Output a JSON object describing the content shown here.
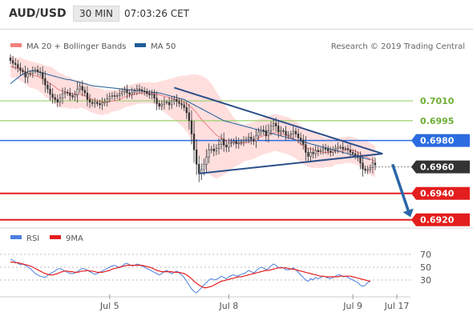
{
  "header": {
    "pair": "AUD/USD",
    "timeframe": "30 MIN",
    "time": "07:03:26 CET"
  },
  "colors": {
    "candle": "#333333",
    "ma20": "#f08080",
    "bollinger_fill": "#ffd3d3",
    "ma50": "#1f5c99",
    "trendline": "#2c4f8a",
    "green_level": "#9bd06a",
    "blue_level": "#2b6ce0",
    "red_level": "#e31e1e",
    "arrow": "#2a66a8",
    "rsi": "#4a7fe0",
    "rsi_ma": "#e61c1c"
  },
  "chart_data": [
    {
      "type": "candlestick",
      "name": "price",
      "legend": [
        {
          "label": "MA 20 + Bollinger Bands",
          "color": "#f08080"
        },
        {
          "label": "MA 50",
          "color": "#1f5c99"
        }
      ],
      "watermark": "Research © 2019 Trading Central",
      "ylim": [
        0.6915,
        0.705
      ],
      "closes": [
        0.70405,
        0.70385,
        0.70375,
        0.7035,
        0.7033,
        0.7032,
        0.7028,
        0.70305,
        0.7031,
        0.70325,
        0.70335,
        0.7032,
        0.70315,
        0.7027,
        0.7022,
        0.7019,
        0.7015,
        0.70125,
        0.7011,
        0.7009,
        0.7012,
        0.70155,
        0.70165,
        0.7016,
        0.7014,
        0.7013,
        0.70145,
        0.7019,
        0.7021,
        0.7018,
        0.7016,
        0.7011,
        0.7009,
        0.7008,
        0.7009,
        0.7008,
        0.7007,
        0.70085,
        0.70095,
        0.70115,
        0.70135,
        0.7014,
        0.70135,
        0.7014,
        0.70155,
        0.7017,
        0.7018,
        0.7016,
        0.7015,
        0.70165,
        0.70175,
        0.7019,
        0.70185,
        0.70175,
        0.7017,
        0.70155,
        0.70145,
        0.7015,
        0.7012,
        0.7008,
        0.7006,
        0.70075,
        0.7009,
        0.7009,
        0.7007,
        0.701,
        0.7011,
        0.70095,
        0.7008,
        0.7007,
        0.7005,
        0.7001,
        0.6995,
        0.6985,
        0.6973,
        0.6962,
        0.6955,
        0.6958,
        0.6962,
        0.69675,
        0.6973,
        0.69735,
        0.6972,
        0.6974,
        0.6977,
        0.6981,
        0.69765,
        0.6975,
        0.6978,
        0.69785,
        0.69795,
        0.69775,
        0.69785,
        0.6979,
        0.698,
        0.6981,
        0.69825,
        0.6981,
        0.69795,
        0.69835,
        0.69865,
        0.6988,
        0.69875,
        0.69835,
        0.69875,
        0.6991,
        0.6993,
        0.6991,
        0.69865,
        0.69875,
        0.6987,
        0.6984,
        0.6984,
        0.6985,
        0.6987,
        0.6985,
        0.6982,
        0.69805,
        0.6977,
        0.6971,
        0.6968,
        0.6971,
        0.697,
        0.69725,
        0.69715,
        0.69725,
        0.6974,
        0.69735,
        0.6972,
        0.6971,
        0.6973,
        0.6974,
        0.6975,
        0.6975,
        0.69735,
        0.6974,
        0.6973,
        0.6971,
        0.697,
        0.6969,
        0.6967,
        0.6963,
        0.69585,
        0.69575,
        0.6958,
        0.69595,
        0.6963,
        0.69615
      ],
      "ma20": [
        0.7036,
        0.70355,
        0.7035,
        0.70345,
        0.7034,
        0.7033,
        0.7032,
        0.7031,
        0.703,
        0.70295,
        0.7029,
        0.70285,
        0.70275,
        0.70265,
        0.7025,
        0.7024,
        0.7023,
        0.7022,
        0.70205,
        0.7019,
        0.7018,
        0.70175,
        0.7017,
        0.70165,
        0.7016,
        0.70155,
        0.7015,
        0.7015,
        0.7015,
        0.70145,
        0.7014,
        0.7013,
        0.7012,
        0.7011,
        0.70105,
        0.701,
        0.70095,
        0.7009,
        0.7009,
        0.7009,
        0.70095,
        0.701,
        0.701,
        0.70105,
        0.7011,
        0.7012,
        0.7013,
        0.70135,
        0.7014,
        0.70145,
        0.7015,
        0.70155,
        0.7016,
        0.7016,
        0.7016,
        0.7016,
        0.7016,
        0.7016,
        0.70155,
        0.7015,
        0.70145,
        0.7014,
        0.70135,
        0.7013,
        0.70125,
        0.7012,
        0.70115,
        0.7011,
        0.70105,
        0.701,
        0.7009,
        0.7008,
        0.70065,
        0.7005,
        0.7003,
        0.7001,
        0.69985,
        0.6996,
        0.6994,
        0.6992,
        0.699,
        0.6988,
        0.6986,
        0.6984,
        0.6983,
        0.6982,
        0.6981,
        0.698,
        0.698,
        0.6979,
        0.69785,
        0.6978,
        0.69775,
        0.69775,
        0.6978,
        0.69785,
        0.6979,
        0.69795,
        0.698,
        0.6981,
        0.6982,
        0.6983,
        0.69835,
        0.6984,
        0.69845,
        0.6985,
        0.6986,
        0.6986,
        0.69855,
        0.6985,
        0.69845,
        0.6984,
        0.69835,
        0.69825,
        0.69815,
        0.69805,
        0.6979,
        0.69775,
        0.6976,
        0.6975,
        0.6974,
        0.69735,
        0.6973,
        0.69725,
        0.6972,
        0.69715,
        0.6971,
        0.6971,
        0.6971,
        0.6971,
        0.69715,
        0.6972,
        0.6972,
        0.6972,
        0.69725,
        0.6973,
        0.6973,
        0.6973,
        0.69725,
        0.6972,
        0.6971,
        0.697,
        0.6969,
        0.6968,
        0.6967,
        0.6966,
        0.6965,
        0.6964
      ],
      "bollinger_width": [
        0.0008,
        0.0008,
        0.0008,
        0.0008,
        0.0009,
        0.0009,
        0.0009,
        0.001,
        0.001,
        0.001,
        0.001,
        0.001,
        0.0011,
        0.0011,
        0.0012,
        0.0012,
        0.0013,
        0.0013,
        0.0013,
        0.0013,
        0.0013,
        0.0013,
        0.0012,
        0.0012,
        0.0012,
        0.0011,
        0.0011,
        0.0011,
        0.001,
        0.001,
        0.001,
        0.001,
        0.001,
        0.001,
        0.001,
        0.001,
        0.001,
        0.001,
        0.0009,
        0.0009,
        0.0009,
        0.0008,
        0.0008,
        0.0008,
        0.0008,
        0.0008,
        0.0008,
        0.0008,
        0.0008,
        0.0008,
        0.0008,
        0.0008,
        0.0008,
        0.0008,
        0.0008,
        0.0008,
        0.0008,
        0.0008,
        0.0008,
        0.0009,
        0.001,
        0.0011,
        0.0012,
        0.0013,
        0.0014,
        0.0015,
        0.0016,
        0.0017,
        0.0018,
        0.0019,
        0.002,
        0.0021,
        0.0023,
        0.0025,
        0.0027,
        0.0029,
        0.0031,
        0.0033,
        0.0034,
        0.0035,
        0.0035,
        0.0035,
        0.0034,
        0.0033,
        0.0031,
        0.0029,
        0.0027,
        0.0025,
        0.0023,
        0.0021,
        0.0019,
        0.0017,
        0.0016,
        0.0015,
        0.0014,
        0.0014,
        0.0014,
        0.0014,
        0.0014,
        0.0014,
        0.0014,
        0.0014,
        0.0014,
        0.0014,
        0.0014,
        0.0014,
        0.0014,
        0.0014,
        0.0014,
        0.0014,
        0.0014,
        0.0014,
        0.0014,
        0.0014,
        0.0014,
        0.0014,
        0.0014,
        0.0014,
        0.0014,
        0.0014,
        0.0014,
        0.0014,
        0.0014,
        0.0013,
        0.0013,
        0.0012,
        0.0012,
        0.0011,
        0.0011,
        0.0011,
        0.0011,
        0.001,
        0.001,
        0.001,
        0.001,
        0.001,
        0.001,
        0.001,
        0.001,
        0.001,
        0.001,
        0.001,
        0.0011,
        0.0012,
        0.0012,
        0.0012,
        0.0012,
        0.0012
      ],
      "ma50": [
        0.7023,
        0.70245,
        0.7026,
        0.70275,
        0.7029,
        0.703,
        0.7031,
        0.7032,
        0.70325,
        0.7033,
        0.70325,
        0.7032,
        0.70315,
        0.7031,
        0.70305,
        0.703,
        0.70295,
        0.7029,
        0.70285,
        0.7028,
        0.70275,
        0.7027,
        0.70265,
        0.7026,
        0.7026,
        0.70255,
        0.7025,
        0.70245,
        0.7024,
        0.70235,
        0.7023,
        0.70225,
        0.7022,
        0.70215,
        0.70212,
        0.7021,
        0.70208,
        0.70206,
        0.70204,
        0.70202,
        0.702,
        0.70198,
        0.70196,
        0.70194,
        0.70192,
        0.7019,
        0.70188,
        0.70186,
        0.70184,
        0.70182,
        0.7018,
        0.70178,
        0.70176,
        0.70174,
        0.70172,
        0.7017,
        0.70168,
        0.70166,
        0.70164,
        0.70162,
        0.7016,
        0.70155,
        0.7015,
        0.70145,
        0.7014,
        0.70135,
        0.7013,
        0.70125,
        0.7012,
        0.70115,
        0.7011,
        0.701,
        0.7009,
        0.7008,
        0.7007,
        0.7006,
        0.7005,
        0.7004,
        0.7003,
        0.7002,
        0.7001,
        0.7,
        0.6999,
        0.6998,
        0.6997,
        0.6996,
        0.6995,
        0.69945,
        0.6994,
        0.69935,
        0.6993,
        0.69925,
        0.6992,
        0.69915,
        0.6991,
        0.69905,
        0.699,
        0.69895,
        0.6989,
        0.69885,
        0.6988,
        0.69875,
        0.6987,
        0.69865,
        0.6986,
        0.69855,
        0.6985,
        0.69845,
        0.6984,
        0.69835,
        0.6983,
        0.69825,
        0.6982,
        0.69815,
        0.6981,
        0.69805,
        0.698,
        0.69795,
        0.6979,
        0.69785,
        0.6978,
        0.69775,
        0.6977,
        0.69765,
        0.6976,
        0.69755,
        0.6975,
        0.69745,
        0.6974,
        0.69735,
        0.6973,
        0.69725,
        0.6972,
        0.69715,
        0.6971,
        0.69705,
        0.697,
        0.69695,
        0.6969,
        0.69685,
        0.6968,
        0.69675,
        0.6967,
        0.69665,
        0.6966,
        0.69655
      ],
      "levels": [
        {
          "label": "0.7010",
          "value": 0.701,
          "style": "green"
        },
        {
          "label": "0.6995",
          "value": 0.6995,
          "style": "green"
        },
        {
          "label": "0.6980",
          "value": 0.698,
          "style": "blue"
        },
        {
          "label": "0.6960",
          "value": 0.696,
          "style": "current"
        },
        {
          "label": "0.6940",
          "value": 0.694,
          "style": "red"
        },
        {
          "label": "0.6920",
          "value": 0.692,
          "style": "red"
        }
      ],
      "trendline_upper": {
        "from": [
          66,
          0.702
        ],
        "to": [
          150,
          0.697
        ]
      },
      "trendline_lower": {
        "from": [
          76,
          0.6955
        ],
        "to": [
          150,
          0.697
        ]
      },
      "forecast_arrow": {
        "from": [
          154,
          0.6962
        ],
        "to": [
          163,
          0.6922
        ]
      }
    },
    {
      "type": "line",
      "name": "rsi",
      "legend": [
        {
          "label": "RSI",
          "color": "#4a7fe0"
        },
        {
          "label": "9MA",
          "color": "#e61c1c"
        }
      ],
      "ylim": [
        10,
        80
      ],
      "ticks": [
        "70",
        "50",
        "30"
      ],
      "rsi": [
        62,
        61,
        58,
        56,
        54,
        55,
        53,
        50,
        48,
        44,
        40,
        38,
        36,
        35,
        34,
        37,
        40,
        42,
        44,
        47,
        48,
        46,
        44,
        42,
        40,
        40,
        41,
        43,
        46,
        48,
        47,
        45,
        43,
        41,
        39,
        40,
        42,
        44,
        46,
        48,
        50,
        52,
        53,
        51,
        49,
        52,
        55,
        56,
        54,
        52,
        53,
        55,
        54,
        52,
        50,
        48,
        46,
        44,
        42,
        40,
        38,
        40,
        43,
        45,
        42,
        40,
        42,
        44,
        41,
        38,
        34,
        28,
        22,
        16,
        12,
        10,
        14,
        18,
        22,
        26,
        30,
        32,
        30,
        31,
        33,
        36,
        34,
        32,
        35,
        37,
        38,
        36,
        37,
        39,
        40,
        42,
        45,
        43,
        41,
        44,
        48,
        50,
        49,
        46,
        48,
        52,
        55,
        53,
        49,
        50,
        49,
        46,
        46,
        47,
        49,
        46,
        42,
        38,
        34,
        30,
        28,
        32,
        30,
        34,
        32,
        34,
        36,
        35,
        33,
        32,
        34,
        36,
        38,
        38,
        35,
        36,
        34,
        32,
        30,
        28,
        26,
        22,
        20,
        22,
        26,
        28
      ],
      "ma9": [
        58,
        58,
        57,
        57,
        56,
        55,
        54,
        53,
        52,
        50,
        48,
        46,
        44,
        42,
        40,
        39,
        38,
        38,
        39,
        40,
        42,
        43,
        44,
        44,
        43,
        43,
        42,
        42,
        43,
        44,
        44,
        45,
        44,
        44,
        43,
        42,
        42,
        42,
        43,
        44,
        45,
        47,
        48,
        49,
        50,
        51,
        52,
        53,
        53,
        53,
        53,
        53,
        53,
        53,
        52,
        51,
        50,
        49,
        47,
        45,
        44,
        43,
        43,
        43,
        43,
        43,
        42,
        42,
        42,
        41,
        40,
        38,
        35,
        32,
        28,
        25,
        22,
        20,
        18,
        18,
        19,
        20,
        22,
        24,
        26,
        28,
        29,
        30,
        31,
        32,
        33,
        34,
        35,
        35,
        36,
        37,
        38,
        39,
        40,
        41,
        42,
        43,
        44,
        45,
        45,
        46,
        47,
        48,
        49,
        49,
        49,
        49,
        48,
        47,
        47,
        46,
        45,
        44,
        43,
        42,
        41,
        40,
        39,
        38,
        37,
        36,
        36,
        35,
        35,
        35,
        35,
        35,
        35,
        36,
        36,
        36,
        36,
        36,
        35,
        34,
        33,
        32,
        31,
        30,
        29,
        28
      ]
    }
  ],
  "x_axis": {
    "ticks": [
      {
        "label": "Jul 5",
        "index": 40
      },
      {
        "label": "Jul 8",
        "index": 88
      },
      {
        "label": "Jul 9",
        "index": 138
      },
      {
        "label": "Jul 17",
        "index": 162
      }
    ]
  }
}
